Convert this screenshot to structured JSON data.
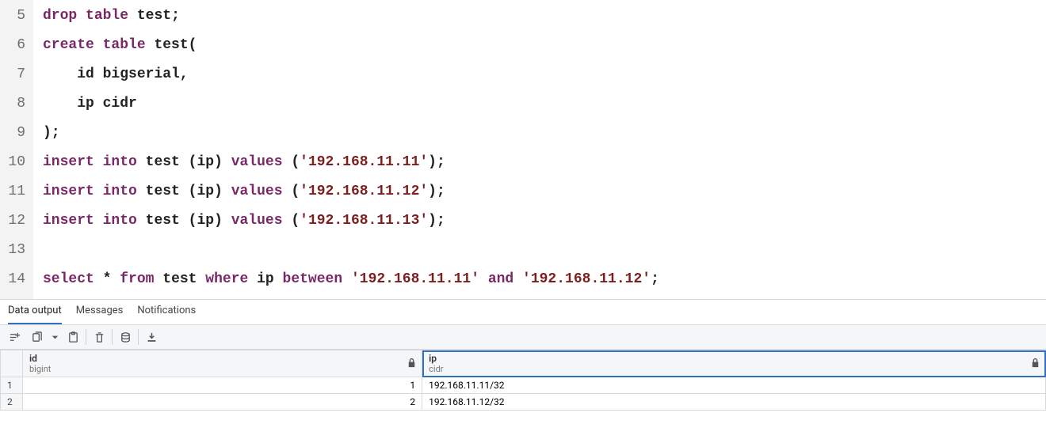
{
  "editor": {
    "startLine": 5,
    "lines": [
      {
        "n": 5,
        "tokens": [
          [
            "kw",
            "drop"
          ],
          [
            "sp",
            " "
          ],
          [
            "kw",
            "table"
          ],
          [
            "sp",
            " "
          ],
          [
            "id",
            "test"
          ],
          [
            "punct",
            ";"
          ]
        ]
      },
      {
        "n": 6,
        "tokens": [
          [
            "kw",
            "create"
          ],
          [
            "sp",
            " "
          ],
          [
            "kw",
            "table"
          ],
          [
            "sp",
            " "
          ],
          [
            "id",
            "test"
          ],
          [
            "punct",
            "("
          ]
        ]
      },
      {
        "n": 7,
        "tokens": [
          [
            "sp",
            "    "
          ],
          [
            "id",
            "id "
          ],
          [
            "id",
            "bigserial"
          ],
          [
            "punct",
            ","
          ]
        ]
      },
      {
        "n": 8,
        "tokens": [
          [
            "sp",
            "    "
          ],
          [
            "id",
            "ip cidr"
          ]
        ]
      },
      {
        "n": 9,
        "tokens": [
          [
            "punct",
            ");"
          ]
        ]
      },
      {
        "n": 10,
        "tokens": [
          [
            "kw",
            "insert"
          ],
          [
            "sp",
            " "
          ],
          [
            "kw",
            "into"
          ],
          [
            "sp",
            " "
          ],
          [
            "id",
            "test "
          ],
          [
            "punct",
            "("
          ],
          [
            "id",
            "ip"
          ],
          [
            "punct",
            ") "
          ],
          [
            "kw",
            "values"
          ],
          [
            "sp",
            " "
          ],
          [
            "punct",
            "("
          ],
          [
            "str",
            "'192.168.11.11'"
          ],
          [
            "punct",
            ");"
          ]
        ]
      },
      {
        "n": 11,
        "tokens": [
          [
            "kw",
            "insert"
          ],
          [
            "sp",
            " "
          ],
          [
            "kw",
            "into"
          ],
          [
            "sp",
            " "
          ],
          [
            "id",
            "test "
          ],
          [
            "punct",
            "("
          ],
          [
            "id",
            "ip"
          ],
          [
            "punct",
            ") "
          ],
          [
            "kw",
            "values"
          ],
          [
            "sp",
            " "
          ],
          [
            "punct",
            "("
          ],
          [
            "str",
            "'192.168.11.12'"
          ],
          [
            "punct",
            ");"
          ]
        ]
      },
      {
        "n": 12,
        "tokens": [
          [
            "kw",
            "insert"
          ],
          [
            "sp",
            " "
          ],
          [
            "kw",
            "into"
          ],
          [
            "sp",
            " "
          ],
          [
            "id",
            "test "
          ],
          [
            "punct",
            "("
          ],
          [
            "id",
            "ip"
          ],
          [
            "punct",
            ") "
          ],
          [
            "kw",
            "values"
          ],
          [
            "sp",
            " "
          ],
          [
            "punct",
            "("
          ],
          [
            "str",
            "'192.168.11.13'"
          ],
          [
            "punct",
            ");"
          ]
        ]
      },
      {
        "n": 13,
        "tokens": []
      },
      {
        "n": 14,
        "tokens": [
          [
            "kw",
            "select"
          ],
          [
            "sp",
            " "
          ],
          [
            "op",
            "*"
          ],
          [
            "sp",
            " "
          ],
          [
            "kw",
            "from"
          ],
          [
            "sp",
            " "
          ],
          [
            "id",
            "test "
          ],
          [
            "kw",
            "where"
          ],
          [
            "sp",
            " "
          ],
          [
            "id",
            "ip "
          ],
          [
            "kw",
            "between"
          ],
          [
            "sp",
            " "
          ],
          [
            "str",
            "'192.168.11.11'"
          ],
          [
            "sp",
            " "
          ],
          [
            "kw",
            "and"
          ],
          [
            "sp",
            " "
          ],
          [
            "str",
            "'192.168.11.12'"
          ],
          [
            "punct",
            ";"
          ]
        ]
      }
    ]
  },
  "tabs": {
    "items": [
      {
        "label": "Data output",
        "active": true
      },
      {
        "label": "Messages",
        "active": false
      },
      {
        "label": "Notifications",
        "active": false
      }
    ]
  },
  "toolbar": {
    "buttons": [
      "add-row",
      "copy",
      "dropdown",
      "paste",
      "delete",
      "save-data",
      "download"
    ]
  },
  "grid": {
    "columns": [
      {
        "name": "id",
        "type": "bigint",
        "locked": true,
        "selected": false
      },
      {
        "name": "ip",
        "type": "cidr",
        "locked": true,
        "selected": true
      }
    ],
    "rows": [
      {
        "n": 1,
        "cells": [
          "1",
          "192.168.11.11/32"
        ]
      },
      {
        "n": 2,
        "cells": [
          "2",
          "192.168.11.12/32"
        ]
      }
    ]
  }
}
